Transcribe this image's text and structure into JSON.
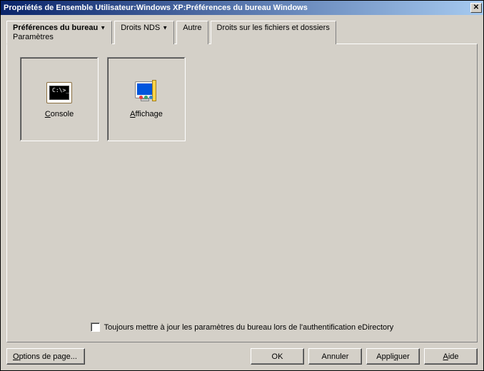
{
  "window": {
    "title": "Propriétés de Ensemble Utilisateur:Windows XP:Préférences du bureau Windows"
  },
  "tabs": {
    "active": {
      "label": "Préférences du bureau",
      "sublabel": "Paramètres"
    },
    "others": [
      {
        "label": "Droits NDS"
      },
      {
        "label": "Autre"
      },
      {
        "label": "Droits sur les fichiers et dossiers"
      }
    ]
  },
  "panel": {
    "items": [
      {
        "label": "Console",
        "icon": "console"
      },
      {
        "label": "Affichage",
        "icon": "display"
      }
    ],
    "checkbox": {
      "label": "Toujours mettre à jour les paramètres du bureau lors de l'authentification eDirectory",
      "checked": false
    }
  },
  "buttons": {
    "page_options": "Options de page...",
    "ok": "OK",
    "cancel": "Annuler",
    "apply": "Appliquer",
    "help": "Aide"
  }
}
